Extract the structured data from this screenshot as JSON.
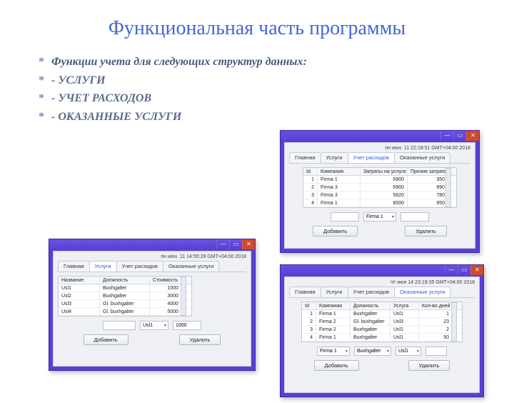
{
  "slide": {
    "title": "Функциональная часть программы",
    "bullets": [
      "Функции учета для следующих структур данных:",
      "- УСЛУГИ",
      "- УЧЕТ РАСХОДОВ",
      "- ОКАЗАННЫЕ УСЛУГИ"
    ]
  },
  "common": {
    "tabs": [
      "Главная",
      "Услуги",
      "Учет расходов",
      "Оказанные услуги"
    ],
    "add_label": "Добавить",
    "delete_label": "Удалить",
    "min_glyph": "—",
    "max_glyph": "▭",
    "close_glyph": "✕"
  },
  "uslugi": {
    "timestamp": "пн июн. 11 14:55:28 GMT+04:00 2018",
    "active_tab_index": 1,
    "columns": [
      "Название",
      "Должность",
      "Стоимость"
    ],
    "rows": [
      [
        "Usl1",
        "Buxhgalter",
        "1000"
      ],
      [
        "Usl2",
        "Buxhgalter",
        "3000"
      ],
      [
        "Usl3",
        "Gl. buxhgalter",
        "4000"
      ],
      [
        "Usl4",
        "Gl. buxhgalter",
        "5000"
      ]
    ],
    "form": {
      "field1": "",
      "drop": "Usl1",
      "field2": "1000"
    }
  },
  "rashody": {
    "timestamp": "пн июн. 11 22:18:51 GMT+04:00 2018",
    "active_tab_index": 2,
    "columns": [
      "Id",
      "Компания",
      "Затраты на услуги",
      "Прочие затраты"
    ],
    "rows": [
      [
        "1",
        "Firma 1",
        "6900",
        "350"
      ],
      [
        "2",
        "Firma 3",
        "6900",
        "890"
      ],
      [
        "3",
        "Firma 3",
        "5820",
        "780"
      ],
      [
        "4",
        "Firma 1",
        "8000",
        "950"
      ]
    ],
    "form": {
      "field1": "",
      "drop": "Firma 1",
      "field2": ""
    }
  },
  "okaz": {
    "timestamp": "Чт июн 14 23:19:35 GMT+04:00 2018",
    "active_tab_index": 3,
    "columns": [
      "Id",
      "Компания",
      "Должность",
      "Услуга",
      "Кол-во дней"
    ],
    "rows": [
      [
        "1",
        "Firma 1",
        "Buxhgalter",
        "Usl1",
        "1"
      ],
      [
        "2",
        "Firma 2",
        "Gl. buxhgalter",
        "Usl3",
        "23"
      ],
      [
        "3",
        "Firma 2",
        "Buxhgalter",
        "Usl1",
        "2"
      ],
      [
        "4",
        "Firma 1",
        "Buxhgalter",
        "Usl1",
        "50"
      ]
    ],
    "form": {
      "drop1": "Firma 1",
      "drop2": "Buxhgalter",
      "drop3": "Usl1",
      "field": ""
    }
  }
}
